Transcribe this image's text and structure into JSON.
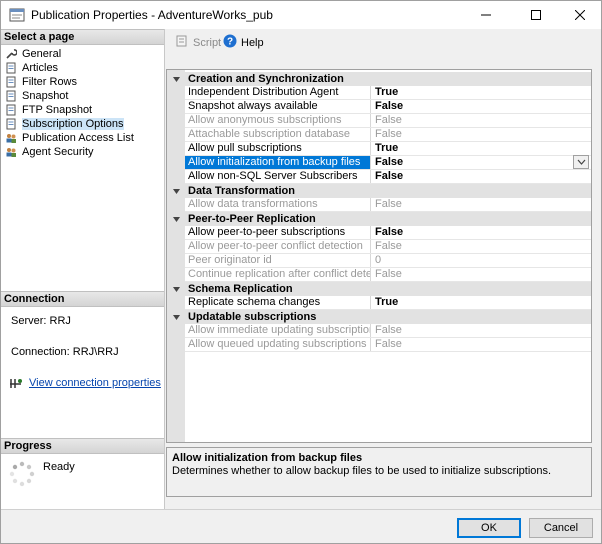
{
  "window": {
    "title": "Publication Properties - AdventureWorks_pub"
  },
  "left": {
    "select_page_header": "Select a page",
    "pages": [
      {
        "label": "General",
        "icon": "wrench-icon"
      },
      {
        "label": "Articles",
        "icon": "page-icon"
      },
      {
        "label": "Filter Rows",
        "icon": "page-icon"
      },
      {
        "label": "Snapshot",
        "icon": "page-icon"
      },
      {
        "label": "FTP Snapshot",
        "icon": "page-icon"
      },
      {
        "label": "Subscription Options",
        "icon": "page-icon"
      },
      {
        "label": "Publication Access List",
        "icon": "users-icon"
      },
      {
        "label": "Agent Security",
        "icon": "users-icon"
      }
    ],
    "connection_header": "Connection",
    "server": "Server: RRJ",
    "connection": "Connection: RRJ\\RRJ",
    "view_link": "View connection properties",
    "progress_header": "Progress",
    "progress_status": "Ready"
  },
  "toolbar": {
    "script": "Script",
    "help": "Help"
  },
  "grid": {
    "categories": [
      {
        "name": "Creation and Synchronization"
      },
      {
        "name": "Data Transformation"
      },
      {
        "name": "Peer-to-Peer Replication"
      },
      {
        "name": "Schema Replication"
      },
      {
        "name": "Updatable subscriptions"
      }
    ],
    "rows": [
      {
        "name": "Independent Distribution Agent",
        "value": "True"
      },
      {
        "name": "Snapshot always available",
        "value": "False"
      },
      {
        "name": "Allow anonymous subscriptions",
        "value": "False"
      },
      {
        "name": "Attachable subscription database",
        "value": "False"
      },
      {
        "name": "Allow pull subscriptions",
        "value": "True"
      },
      {
        "name": "Allow initialization from backup files",
        "value": "False"
      },
      {
        "name": "Allow non-SQL Server Subscribers",
        "value": "False"
      },
      {
        "name": "Allow data transformations",
        "value": "False"
      },
      {
        "name": "Allow peer-to-peer subscriptions",
        "value": "False"
      },
      {
        "name": "Allow peer-to-peer conflict detection",
        "value": "False"
      },
      {
        "name": "Peer originator id",
        "value": "0"
      },
      {
        "name": "Continue replication after conflict detection",
        "value": "False"
      },
      {
        "name": "Replicate schema changes",
        "value": "True"
      },
      {
        "name": "Allow immediate updating subscriptions",
        "value": "False"
      },
      {
        "name": "Allow queued updating subscriptions",
        "value": "False"
      }
    ]
  },
  "description": {
    "title": "Allow initialization from backup files",
    "text": "Determines whether to allow backup files to be used to initialize subscriptions."
  },
  "buttons": {
    "ok": "OK",
    "cancel": "Cancel"
  }
}
